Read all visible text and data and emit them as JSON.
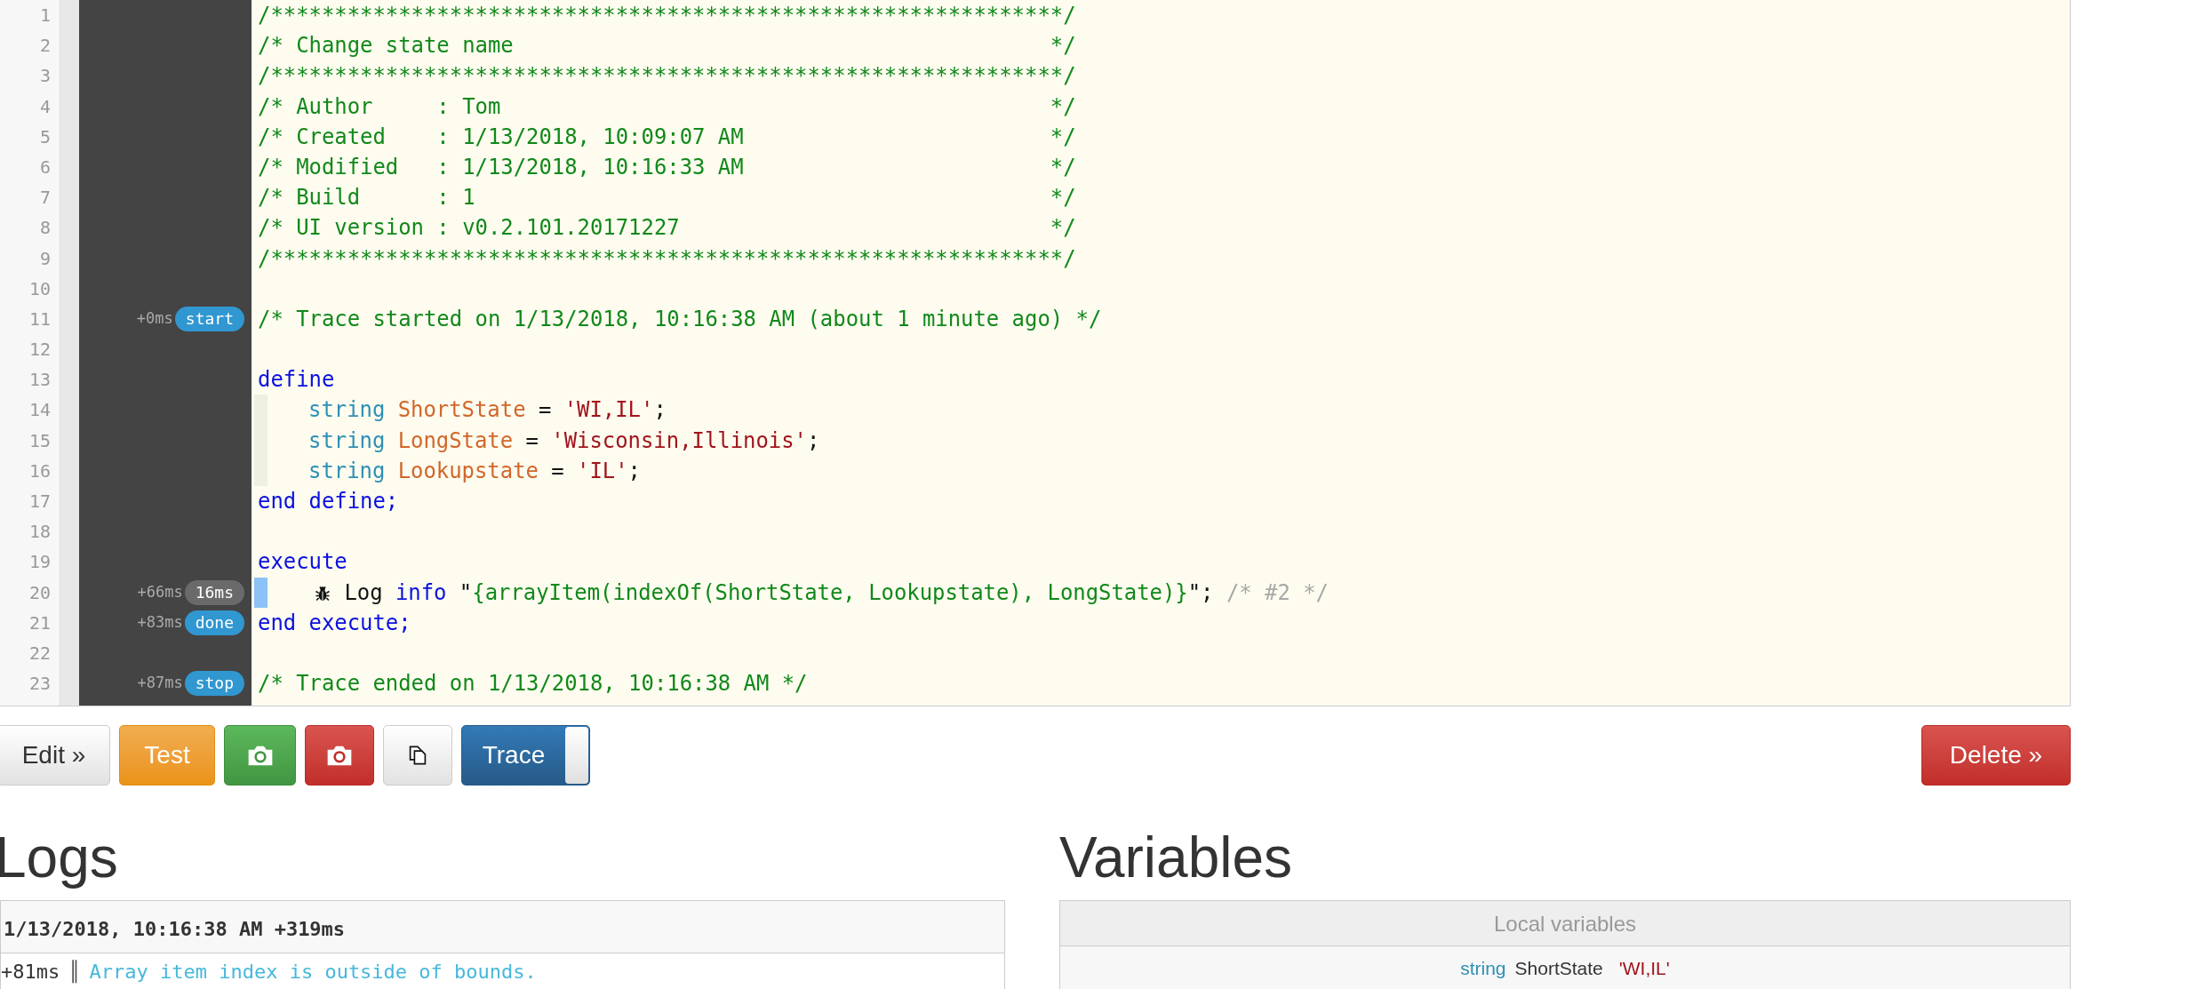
{
  "editor": {
    "lines": [
      {
        "number": "1",
        "tokens": [
          {
            "kind": "comment",
            "text": "/**************************************************************/"
          }
        ]
      },
      {
        "number": "2",
        "tokens": [
          {
            "kind": "comment",
            "text": "/* Change state name                                          */"
          }
        ]
      },
      {
        "number": "3",
        "tokens": [
          {
            "kind": "comment",
            "text": "/**************************************************************/"
          }
        ]
      },
      {
        "number": "4",
        "tokens": [
          {
            "kind": "comment",
            "text": "/* Author     : Tom                                           */"
          }
        ]
      },
      {
        "number": "5",
        "tokens": [
          {
            "kind": "comment",
            "text": "/* Created    : 1/13/2018, 10:09:07 AM                        */"
          }
        ]
      },
      {
        "number": "6",
        "tokens": [
          {
            "kind": "comment",
            "text": "/* Modified   : 1/13/2018, 10:16:33 AM                        */"
          }
        ]
      },
      {
        "number": "7",
        "tokens": [
          {
            "kind": "comment",
            "text": "/* Build      : 1                                             */"
          }
        ]
      },
      {
        "number": "8",
        "tokens": [
          {
            "kind": "comment",
            "text": "/* UI version : v0.2.101.20171227                             */"
          }
        ]
      },
      {
        "number": "9",
        "tokens": [
          {
            "kind": "comment",
            "text": "/**************************************************************/"
          }
        ]
      },
      {
        "number": "10"
      },
      {
        "number": "11",
        "time": "+0ms",
        "badge": {
          "text": "start",
          "kind": "event"
        },
        "tokens": [
          {
            "kind": "comment",
            "text": "/* Trace started on 1/13/2018, 10:16:38 AM (about 1 minute ago) */"
          }
        ]
      },
      {
        "number": "12"
      },
      {
        "number": "13",
        "tokens": [
          {
            "kind": "keyword",
            "text": "define"
          }
        ]
      },
      {
        "number": "14",
        "indent_guide": true,
        "tokens": [
          {
            "kind": "type",
            "text": "string "
          },
          {
            "kind": "variable",
            "text": "ShortState"
          },
          {
            "kind": "plain",
            "text": " = "
          },
          {
            "kind": "string",
            "text": "'WI,IL'"
          },
          {
            "kind": "plain",
            "text": ";"
          }
        ]
      },
      {
        "number": "15",
        "indent_guide": true,
        "tokens": [
          {
            "kind": "type",
            "text": "string "
          },
          {
            "kind": "variable",
            "text": "LongState"
          },
          {
            "kind": "plain",
            "text": " = "
          },
          {
            "kind": "string",
            "text": "'Wisconsin,Illinois'"
          },
          {
            "kind": "plain",
            "text": ";"
          }
        ]
      },
      {
        "number": "16",
        "indent_guide": true,
        "tokens": [
          {
            "kind": "type",
            "text": "string "
          },
          {
            "kind": "variable",
            "text": "Lookupstate"
          },
          {
            "kind": "plain",
            "text": " = "
          },
          {
            "kind": "string",
            "text": "'IL'"
          },
          {
            "kind": "plain",
            "text": ";"
          }
        ]
      },
      {
        "number": "17",
        "tokens": [
          {
            "kind": "keyword",
            "text": "end define;"
          }
        ]
      },
      {
        "number": "18"
      },
      {
        "number": "19",
        "tokens": [
          {
            "kind": "keyword",
            "text": "execute"
          }
        ]
      },
      {
        "number": "20",
        "time": "+66ms",
        "badge": {
          "text": "16ms",
          "kind": "duration"
        },
        "current": true,
        "tokens": [
          {
            "kind": "bug"
          },
          {
            "kind": "plain",
            "text": " Log "
          },
          {
            "kind": "keyword",
            "text": "info"
          },
          {
            "kind": "plain",
            "text": " \""
          },
          {
            "kind": "comment",
            "text": "{arrayItem(indexOf(ShortState, Lookupstate), LongState)}"
          },
          {
            "kind": "plain",
            "text": "\"; "
          },
          {
            "kind": "faded",
            "text": "/* #2 */"
          }
        ]
      },
      {
        "number": "21",
        "time": "+83ms",
        "badge": {
          "text": "done",
          "kind": "event"
        },
        "tokens": [
          {
            "kind": "keyword",
            "text": "end execute;"
          }
        ]
      },
      {
        "number": "22"
      },
      {
        "number": "23",
        "time": "+87ms",
        "badge": {
          "text": "stop",
          "kind": "event"
        },
        "tokens": [
          {
            "kind": "comment",
            "text": "/* Trace ended on 1/13/2018, 10:16:38 AM */"
          }
        ]
      }
    ]
  },
  "toolbar": {
    "edit": "Edit »",
    "test": "Test",
    "trace": {
      "label": "Trace",
      "on": true
    },
    "delete": "Delete »"
  },
  "logs": {
    "title": "Logs",
    "header": "1/13/2018, 10:16:38 AM +319ms",
    "entries": [
      {
        "time": "+81ms",
        "separator": "║",
        "message": "Array item index is outside of bounds."
      }
    ]
  },
  "variables": {
    "title": "Variables",
    "header": "Local variables",
    "rows": [
      {
        "type": "string",
        "name": "ShortState",
        "value": "'WI,IL'"
      }
    ]
  }
}
